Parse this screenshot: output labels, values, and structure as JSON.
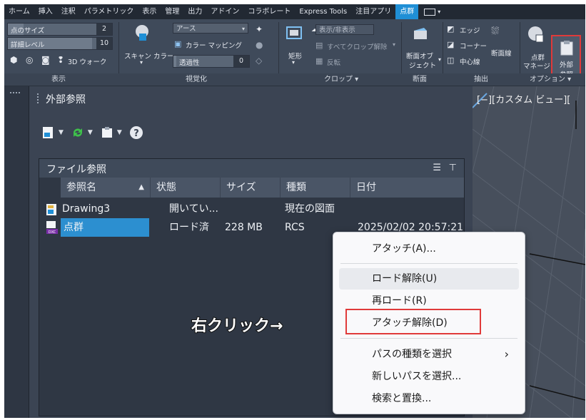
{
  "tabs": [
    "ホーム",
    "挿入",
    "注釈",
    "パラメトリック",
    "表示",
    "管理",
    "出力",
    "アドイン",
    "コラボレート",
    "Express Tools",
    "注目アプリ",
    "点群"
  ],
  "active_tab": "点群",
  "ribbon": {
    "display": {
      "point_size_label": "点のサイズ",
      "point_size_value": "2",
      "detail_label": "詳細レベル",
      "detail_value": "10",
      "walk_label": "3D ウォーク",
      "panel_label": "表示"
    },
    "visual": {
      "scan_color_label": "スキャン カラー",
      "dropdown_value": "アース",
      "color_mapping_label": "カラー マッピング",
      "transparency_label": "透過性",
      "transparency_value": "0",
      "panel_label": "視覚化"
    },
    "crop": {
      "rect_label": "矩形",
      "show_hide_label": "表示/非表示",
      "remove_all_label": "すべてクロップ解除",
      "invert_label": "反転",
      "panel_label": "クロップ ▾"
    },
    "section": {
      "object_label_1": "断面オブ",
      "object_label_2": "ジェクト",
      "panel_label": "断面"
    },
    "extract": {
      "edge_label": "エッジ",
      "corner_label": "コーナー",
      "centerline_label": "中心線",
      "section_line_label": "断面線",
      "panel_label": "抽出"
    },
    "options": {
      "manager_label_1": "点群",
      "manager_label_2": "マネージャ",
      "xref_label_1": "外部",
      "xref_label_2": "参照",
      "panel_label": "オプション ▾"
    }
  },
  "palette": {
    "title": "外部参照",
    "section_title": "ファイル参照",
    "columns": [
      "参照名",
      "▲",
      "状態",
      "サイズ",
      "種類",
      "日付"
    ],
    "rows": [
      {
        "name": "Drawing3",
        "status": "開いてい...",
        "size": "",
        "type": "現在の図面",
        "date": ""
      },
      {
        "name": "点群",
        "status": "ロード済",
        "size": "228 MB",
        "type": "RCS",
        "date": "2025/02/02 20:57:21"
      }
    ]
  },
  "viewport": {
    "label": "[−][カスタム ビュー]["
  },
  "context_menu": {
    "items": [
      "アタッチ(A)...",
      "ロード解除(U)",
      "再ロード(R)",
      "アタッチ解除(D)",
      "パスの種類を選択",
      "新しいパスを選択...",
      "検索と置換..."
    ],
    "submenu_arrow": "›"
  },
  "annotation": "右クリック→",
  "colors": {
    "accent": "#1f8fd6",
    "highlight_red": "#e03a3a",
    "selection": "#2c8fd0"
  }
}
